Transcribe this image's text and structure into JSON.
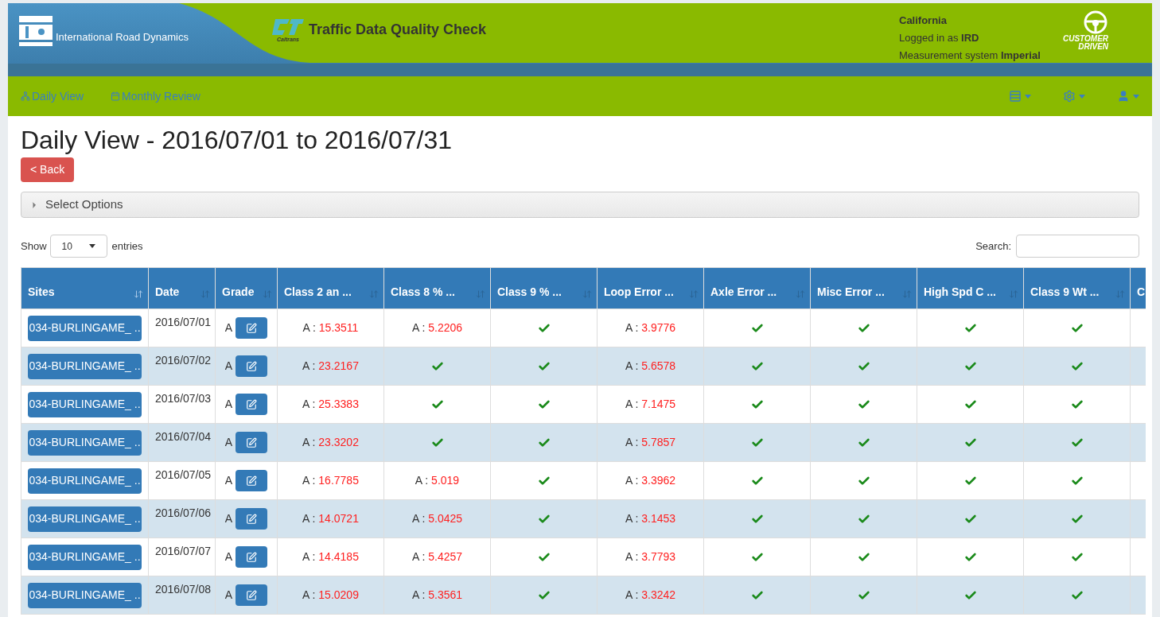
{
  "header": {
    "company": "International Road Dynamics",
    "app_title": "Traffic Data Quality Check",
    "logo_caption": "Caltrans",
    "state": "California",
    "login_label": "Logged in as",
    "login_user": "IRD",
    "measure_label": "Measurement system",
    "measure_value": "Imperial",
    "badge_line1": "CUSTOMER",
    "badge_line2": "DRIVEN"
  },
  "nav": [
    {
      "label": "Daily View"
    },
    {
      "label": "Monthly Review"
    }
  ],
  "page_title": "Daily View - 2016/07/01 to 2016/07/31",
  "back_button": "< Back",
  "options_panel": {
    "label": "Select Options",
    "expanded": false
  },
  "length": {
    "show": "Show",
    "value": "10",
    "entries": "entries"
  },
  "search": {
    "label": "Search:"
  },
  "table": {
    "columns": [
      {
        "label": "Sites",
        "sorted": true
      },
      {
        "label": "Date",
        "sorted": false
      },
      {
        "label": "Grade",
        "sorted": false
      },
      {
        "label": "Class 2 an ...",
        "sorted": false
      },
      {
        "label": "Class 8 % ...",
        "sorted": false
      },
      {
        "label": "Class 9 % ...",
        "sorted": false
      },
      {
        "label": "Loop Error ...",
        "sorted": false
      },
      {
        "label": "Axle Error ...",
        "sorted": false
      },
      {
        "label": "Misc Error ...",
        "sorted": false
      },
      {
        "label": "High Spd C ...",
        "sorted": false
      },
      {
        "label": "Class 9 Wt ...",
        "sorted": false
      },
      {
        "label": "C"
      }
    ],
    "rows": [
      {
        "cells": [
          {
            "kind": "site",
            "text": "034-BURLINGAME_ .."
          },
          {
            "kind": "date",
            "text": "2016/07/01"
          },
          {
            "kind": "grade",
            "text": "A"
          },
          {
            "kind": "value",
            "grade": "A :",
            "value": "15.3511"
          },
          {
            "kind": "value",
            "grade": "A :",
            "value": "5.2206"
          },
          {
            "kind": "check"
          },
          {
            "kind": "value",
            "grade": "A :",
            "value": "3.9776"
          },
          {
            "kind": "check"
          },
          {
            "kind": "check"
          },
          {
            "kind": "check"
          },
          {
            "kind": "check"
          },
          ""
        ]
      },
      {
        "cells": [
          {
            "kind": "site",
            "text": "034-BURLINGAME_ .."
          },
          {
            "kind": "date",
            "text": "2016/07/02"
          },
          {
            "kind": "grade",
            "text": "A"
          },
          {
            "kind": "value",
            "grade": "A :",
            "value": "23.2167"
          },
          {
            "kind": "check"
          },
          {
            "kind": "check"
          },
          {
            "kind": "value",
            "grade": "A :",
            "value": "5.6578"
          },
          {
            "kind": "check"
          },
          {
            "kind": "check"
          },
          {
            "kind": "check"
          },
          {
            "kind": "check"
          },
          ""
        ]
      },
      {
        "cells": [
          {
            "kind": "site",
            "text": "034-BURLINGAME_ .."
          },
          {
            "kind": "date",
            "text": "2016/07/03"
          },
          {
            "kind": "grade",
            "text": "A"
          },
          {
            "kind": "value",
            "grade": "A :",
            "value": "25.3383"
          },
          {
            "kind": "check"
          },
          {
            "kind": "check"
          },
          {
            "kind": "value",
            "grade": "A :",
            "value": "7.1475"
          },
          {
            "kind": "check"
          },
          {
            "kind": "check"
          },
          {
            "kind": "check"
          },
          {
            "kind": "check"
          },
          ""
        ]
      },
      {
        "cells": [
          {
            "kind": "site",
            "text": "034-BURLINGAME_ .."
          },
          {
            "kind": "date",
            "text": "2016/07/04"
          },
          {
            "kind": "grade",
            "text": "A"
          },
          {
            "kind": "value",
            "grade": "A :",
            "value": "23.3202"
          },
          {
            "kind": "check"
          },
          {
            "kind": "check"
          },
          {
            "kind": "value",
            "grade": "A :",
            "value": "5.7857"
          },
          {
            "kind": "check"
          },
          {
            "kind": "check"
          },
          {
            "kind": "check"
          },
          {
            "kind": "check"
          },
          ""
        ]
      },
      {
        "cells": [
          {
            "kind": "site",
            "text": "034-BURLINGAME_ .."
          },
          {
            "kind": "date",
            "text": "2016/07/05"
          },
          {
            "kind": "grade",
            "text": "A"
          },
          {
            "kind": "value",
            "grade": "A :",
            "value": "16.7785"
          },
          {
            "kind": "value",
            "grade": "A :",
            "value": "5.019"
          },
          {
            "kind": "check"
          },
          {
            "kind": "value",
            "grade": "A :",
            "value": "3.3962"
          },
          {
            "kind": "check"
          },
          {
            "kind": "check"
          },
          {
            "kind": "check"
          },
          {
            "kind": "check"
          },
          ""
        ]
      },
      {
        "cells": [
          {
            "kind": "site",
            "text": "034-BURLINGAME_ .."
          },
          {
            "kind": "date",
            "text": "2016/07/06"
          },
          {
            "kind": "grade",
            "text": "A"
          },
          {
            "kind": "value",
            "grade": "A :",
            "value": "14.0721"
          },
          {
            "kind": "value",
            "grade": "A :",
            "value": "5.0425"
          },
          {
            "kind": "check"
          },
          {
            "kind": "value",
            "grade": "A :",
            "value": "3.1453"
          },
          {
            "kind": "check"
          },
          {
            "kind": "check"
          },
          {
            "kind": "check"
          },
          {
            "kind": "check"
          },
          ""
        ]
      },
      {
        "cells": [
          {
            "kind": "site",
            "text": "034-BURLINGAME_ .."
          },
          {
            "kind": "date",
            "text": "2016/07/07"
          },
          {
            "kind": "grade",
            "text": "A"
          },
          {
            "kind": "value",
            "grade": "A :",
            "value": "14.4185"
          },
          {
            "kind": "value",
            "grade": "A :",
            "value": "5.4257"
          },
          {
            "kind": "check"
          },
          {
            "kind": "value",
            "grade": "A :",
            "value": "3.7793"
          },
          {
            "kind": "check"
          },
          {
            "kind": "check"
          },
          {
            "kind": "check"
          },
          {
            "kind": "check"
          },
          ""
        ]
      },
      {
        "cells": [
          {
            "kind": "site",
            "text": "034-BURLINGAME_ .."
          },
          {
            "kind": "date",
            "text": "2016/07/08"
          },
          {
            "kind": "grade",
            "text": "A"
          },
          {
            "kind": "value",
            "grade": "A :",
            "value": "15.0209"
          },
          {
            "kind": "value",
            "grade": "A :",
            "value": "5.3561"
          },
          {
            "kind": "check"
          },
          {
            "kind": "value",
            "grade": "A :",
            "value": "3.3242"
          },
          {
            "kind": "check"
          },
          {
            "kind": "check"
          },
          {
            "kind": "check"
          },
          {
            "kind": "check"
          },
          ""
        ]
      }
    ]
  }
}
